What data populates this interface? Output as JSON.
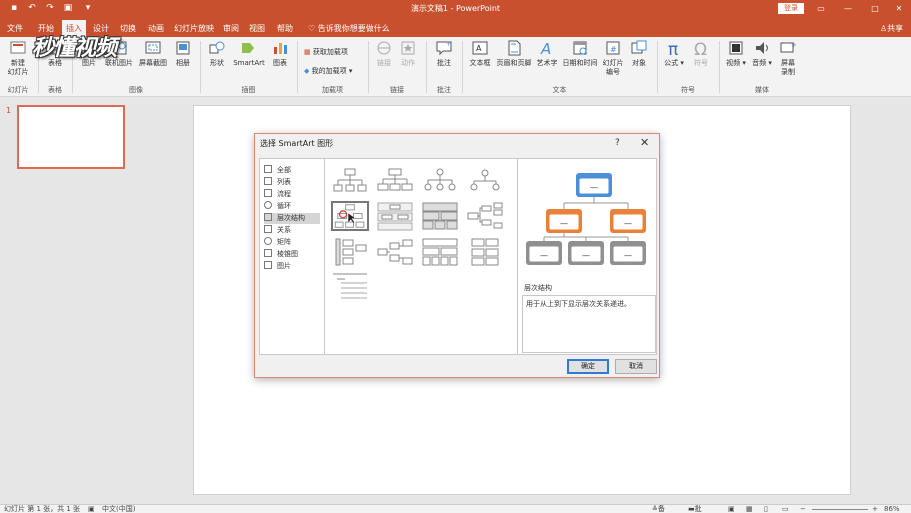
{
  "titlebar": {
    "doc_title": "演示文稿1 - PowerPoint",
    "login_label": "登录",
    "quick_access": [
      "save-icon",
      "undo-icon",
      "redo-icon",
      "start-from-beginning-icon",
      "customize-icon"
    ],
    "window_buttons": [
      "ribbon-options-icon",
      "minimize-icon",
      "maximize-icon",
      "close-icon"
    ]
  },
  "tabs": {
    "items": [
      "文件",
      "开始",
      "插入",
      "设计",
      "切换",
      "动画",
      "幻灯片放映",
      "审阅",
      "视图",
      "帮助"
    ],
    "active": "插入",
    "tell_me": "告诉我你想要做什么",
    "share": "共享"
  },
  "ribbon": {
    "new_slide": [
      "新建",
      "幻灯片"
    ],
    "table": "表格",
    "picture": "图片",
    "online_picture": "联机图片",
    "screenshot": "屏幕截图",
    "album": "相册",
    "shape": "形状",
    "smartart": "SmartArt",
    "chart": "图表",
    "get_addins": "获取加载项",
    "my_addins": "我的加载项",
    "link": "链接",
    "action": "动作",
    "comment": "批注",
    "textbox": "文本框",
    "header_footer": "页眉和页脚",
    "wordart": "艺术字",
    "datetime": "日期和时间",
    "slide_number": [
      "幻灯片",
      "编号"
    ],
    "object": "对象",
    "equation": "公式",
    "symbol": "符号",
    "video": "视频",
    "audio": "音频",
    "screen_recording": [
      "屏幕",
      "录制"
    ],
    "groups": [
      "幻灯片",
      "表格",
      "图像",
      "插图",
      "加载项",
      "链接",
      "批注",
      "文本",
      "符号",
      "媒体"
    ]
  },
  "watermark": "秒懂视频",
  "thumbnails": {
    "slide_number": "1"
  },
  "dialog": {
    "title": "选择 SmartArt 图形",
    "help": "?",
    "close": "✕",
    "categories": [
      "全部",
      "列表",
      "流程",
      "循环",
      "层次结构",
      "关系",
      "矩阵",
      "棱锥图",
      "图片"
    ],
    "selected_category": "层次结构",
    "preview_title": "层次结构",
    "preview_description": "用于从上到下显示层次关系递进。",
    "ok_label": "确定",
    "cancel_label": "取消",
    "preview_box_labels": [
      "—",
      "—",
      "—",
      "—",
      "—",
      "—",
      "—"
    ],
    "colors": {
      "top_box": "#4a8fd8",
      "mid_box": "#e8813a",
      "bottom_box": "#909090"
    }
  },
  "statusbar": {
    "slide_info": "幻灯片 第 1 张，共 1 张",
    "language": "中文(中国)",
    "notes": "备注",
    "comments": "批注",
    "zoom": "86%"
  }
}
